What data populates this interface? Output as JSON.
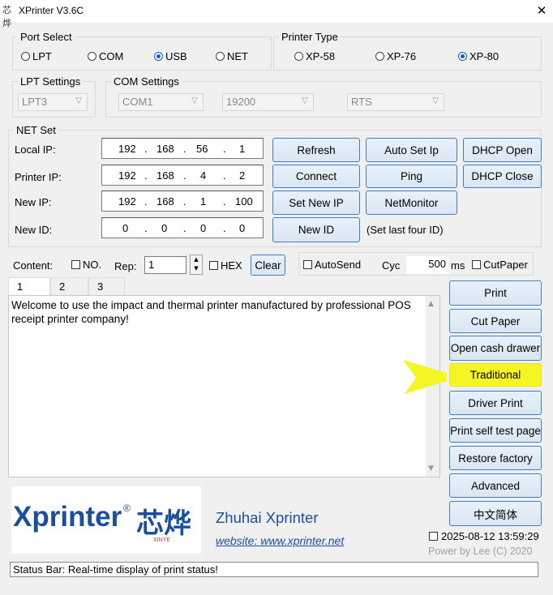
{
  "window": {
    "title": "XPrinter V3.6C",
    "close_glyph": "✕"
  },
  "port_select": {
    "legend": "Port Select",
    "options": [
      "LPT",
      "COM",
      "USB",
      "NET"
    ],
    "selected": "USB"
  },
  "printer_type": {
    "legend": "Printer Type",
    "options": [
      "XP-58",
      "XP-76",
      "XP-80"
    ],
    "selected": "XP-80"
  },
  "lpt_settings": {
    "legend": "LPT Settings",
    "value": "LPT3"
  },
  "com_settings": {
    "legend": "COM Settings",
    "port": "COM1",
    "baud": "19200",
    "flow": "RTS"
  },
  "net_set": {
    "legend": "NET Set",
    "rows": [
      {
        "label": "Local IP:",
        "octets": [
          "192",
          "168",
          "56",
          "1"
        ]
      },
      {
        "label": "Printer IP:",
        "octets": [
          "192",
          "168",
          "4",
          "2"
        ]
      },
      {
        "label": "New IP:",
        "octets": [
          "192",
          "168",
          "1",
          "100"
        ]
      },
      {
        "label": "New ID:",
        "octets": [
          "0",
          "0",
          "0",
          "0"
        ]
      }
    ],
    "buttons": {
      "refresh": "Refresh",
      "auto_set_ip": "Auto Set Ip",
      "dhcp_open": "DHCP Open",
      "connect": "Connect",
      "ping": "Ping",
      "dhcp_close": "DHCP Close",
      "set_new_ip": "Set New IP",
      "netmonitor": "NetMonitor",
      "new_id": "New ID"
    },
    "new_id_hint": "(Set last four ID)"
  },
  "content_bar": {
    "content_label": "Content:",
    "no_label": "NO.",
    "rep_label": "Rep:",
    "rep_value": "1",
    "hex_label": "HEX",
    "clear_label": "Clear",
    "autosend_label": "AutoSend",
    "cyc_label": "Cyc",
    "cyc_value": "500",
    "ms_label": "ms",
    "cutpaper_label": "CutPaper"
  },
  "tabs": [
    "1",
    "2",
    "3"
  ],
  "content_text": "Welcome to use the impact and thermal printer manufactured by professional POS receipt printer company!",
  "side_buttons": [
    "Print",
    "Cut Paper",
    "Open cash drawer",
    "Traditional",
    "Driver Print",
    "Print self test page",
    "Restore factory",
    "Advanced",
    "中文简体"
  ],
  "highlight_color": "#f5f525",
  "logo": {
    "brand": "Xprinter",
    "registered": "®",
    "chinese": "芯烨",
    "sub": "XINYE",
    "color": "#1a4f9e"
  },
  "company": {
    "name": "Zhuhai Xprinter",
    "website": "website: www.xprinter.net"
  },
  "datetime": "2025-08-12 13:59:29",
  "powered_by": "Power by Lee (C) 2020",
  "status_bar": "Status Bar: Real-time display of print status!"
}
